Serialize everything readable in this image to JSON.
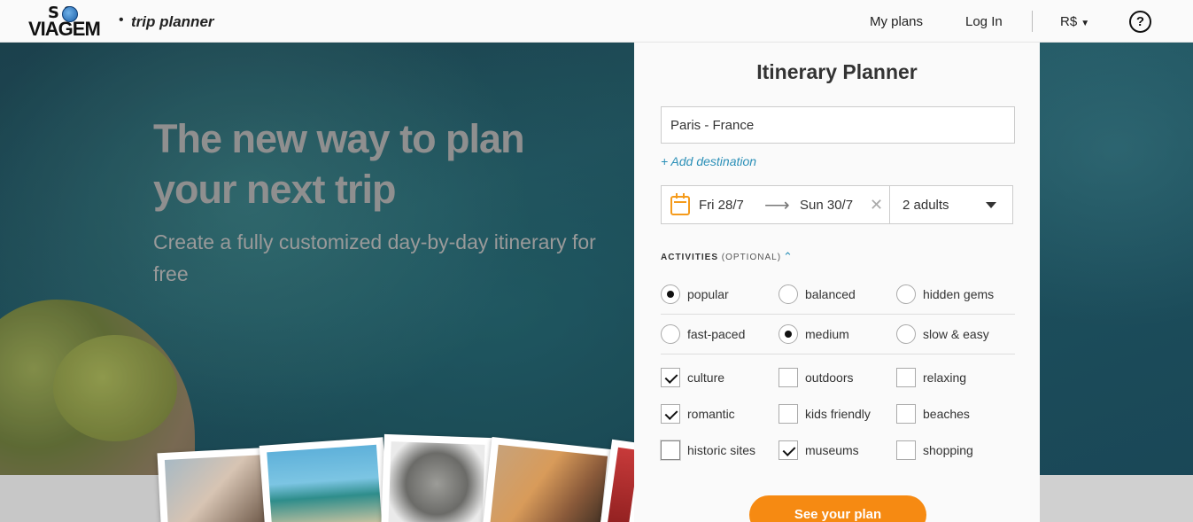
{
  "header": {
    "logo_text": "SOS VIAGEM",
    "logo_top": "S S",
    "logo_bottom": "VIAGEM",
    "separator": "•",
    "brand_name": "trip planner",
    "nav": {
      "my_plans": "My plans",
      "log_in": "Log In",
      "currency": "R$",
      "help": "?"
    }
  },
  "hero": {
    "title": "The new way to plan your next trip",
    "subtitle": "Create a fully customized day-by-day itinerary for free"
  },
  "planner": {
    "title": "Itinerary Planner",
    "destination_value": "Paris - France",
    "add_destination": "+ Add destination",
    "date_from": "Fri 28/7",
    "date_arrow": "⟶",
    "date_to": "Sun 30/7",
    "date_clear": "✕",
    "travelers": "2 adults",
    "activities_label": "ACTIVITIES",
    "activities_optional": "(OPTIONAL)",
    "activities_caret": "⌃",
    "popularity": [
      {
        "label": "popular",
        "selected": true
      },
      {
        "label": "balanced",
        "selected": false
      },
      {
        "label": "hidden gems",
        "selected": false
      }
    ],
    "pace": [
      {
        "label": "fast-paced",
        "selected": false
      },
      {
        "label": "medium",
        "selected": true
      },
      {
        "label": "slow & easy",
        "selected": false
      }
    ],
    "interests": [
      {
        "label": "culture",
        "checked": true
      },
      {
        "label": "outdoors",
        "checked": false
      },
      {
        "label": "relaxing",
        "checked": false
      },
      {
        "label": "romantic",
        "checked": true
      },
      {
        "label": "kids friendly",
        "checked": false
      },
      {
        "label": "beaches",
        "checked": false
      },
      {
        "label": "historic sites",
        "checked": false
      },
      {
        "label": "museums",
        "checked": true
      },
      {
        "label": "shopping",
        "checked": false
      }
    ],
    "submit": "See your plan"
  },
  "colors": {
    "accent": "#f68a12",
    "link": "#2a8fb7",
    "calendar_icon": "#f59b1c"
  }
}
